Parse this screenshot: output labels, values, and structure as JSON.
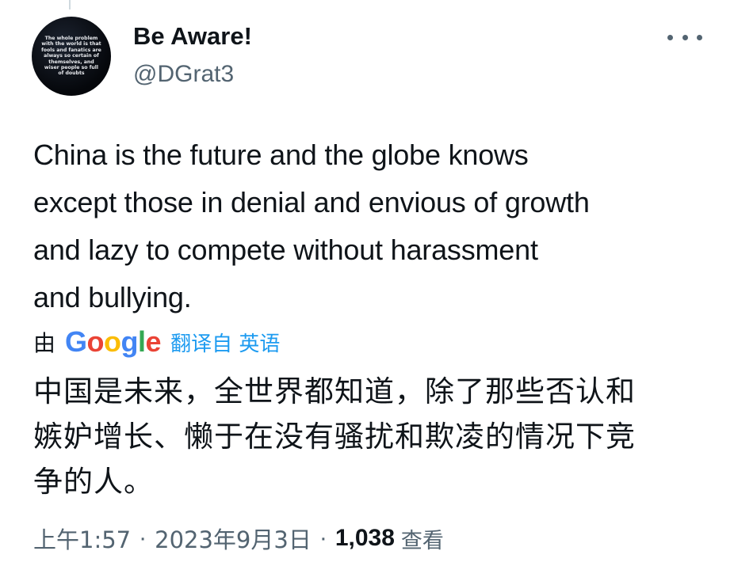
{
  "author": {
    "display_name": "Be Aware!",
    "handle": "@DGrat3",
    "avatar_quote": "The whole problem with the world is that fools and fanatics are always so certain of themselves, and wiser people so full of doubts"
  },
  "tweet": {
    "lines": [
      "China is the future and the globe knows",
      "except those in denial and envious of growth",
      "and lazy to compete without harassment",
      "and bullying."
    ]
  },
  "translation": {
    "prefix": "由",
    "provider_letters": [
      "G",
      "o",
      "o",
      "g",
      "l",
      "e"
    ],
    "link_label": "翻译自 英语",
    "lines": [
      "中国是未来，全世界都知道，除了那些否认和",
      "嫉妒增长、懒于在没有骚扰和欺凌的情况下竞",
      "争的人。"
    ]
  },
  "meta": {
    "time": "上午1:57",
    "separator": "·",
    "date": "2023年9月3日",
    "views_count": "1,038",
    "views_label": "查看"
  },
  "colors": {
    "text_primary": "#0f1419",
    "text_secondary": "#536471",
    "link": "#1d9bf0",
    "google_blue": "#4285f4",
    "google_red": "#ea4335",
    "google_yellow": "#fbbc05",
    "google_green": "#34a853"
  },
  "icons": {
    "more": "more-horizontal-icon"
  }
}
